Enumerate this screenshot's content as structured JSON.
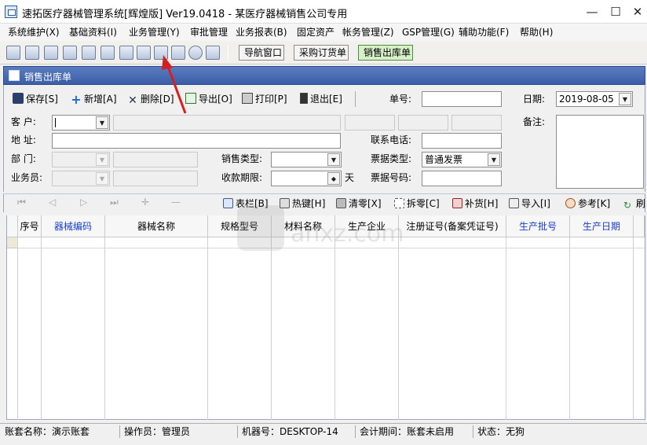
{
  "window": {
    "title": "速拓医疗器械管理系统[辉煌版] Ver19.0418 - 某医疗器械销售公司专用",
    "min_label": "—",
    "max_label": "☐",
    "close_label": "✕"
  },
  "menu": [
    "系统维护(X)",
    "基础资料(I)",
    "业务管理(Y)",
    "审批管理",
    "业务报表(B)",
    "固定资产",
    "帐务管理(Z)",
    "GSP管理(G)",
    "辅助功能(F)",
    "帮助(H)"
  ],
  "toolbar": {
    "nav_window": "导航窗口",
    "purchase_order": "采购订货单",
    "sales_out": "销售出库单"
  },
  "panel": {
    "title": "销售出库单"
  },
  "actions": {
    "save": "保存[S]",
    "add": "新增[A]",
    "delete": "删除[D]",
    "export": "导出[O]",
    "print": "打印[P]",
    "exit": "退出[E]"
  },
  "form": {
    "order_no_label": "单号:",
    "order_no": "",
    "date_label": "日期:",
    "date": "2019-08-05",
    "customer_label": "客    户:",
    "address_label": "地    址:",
    "dept_label": "部    门:",
    "salesman_label": "业务员:",
    "sale_type_label": "销售类型:",
    "term_label": "收款期限:",
    "term_unit": "天",
    "phone_label": "联系电话:",
    "invoice_type_label": "票据类型:",
    "invoice_type": "普通发票",
    "invoice_no_label": "票据号码:",
    "remark_label": "备注:"
  },
  "grid_tools": {
    "columns": "表栏[B]",
    "hotkey": "热键[H]",
    "clear": "清零[X]",
    "split": "拆零[C]",
    "restock": "补货[H]",
    "import": "导入[I]",
    "reference": "参考[K]",
    "more": "刷"
  },
  "grid": {
    "columns": [
      {
        "label": "序号",
        "blue": false
      },
      {
        "label": "器械编码",
        "blue": true
      },
      {
        "label": "器械名称",
        "blue": false
      },
      {
        "label": "规格型号",
        "blue": false
      },
      {
        "label": "材料名称",
        "blue": false
      },
      {
        "label": "生产企业",
        "blue": false
      },
      {
        "label": "注册证号(备案凭证号)",
        "blue": false
      },
      {
        "label": "生产批号",
        "blue": true
      },
      {
        "label": "生产日期",
        "blue": true
      }
    ]
  },
  "watermark": {
    "text": "anxz.com"
  },
  "status": {
    "account": "账套名称：演示账套",
    "operator": "操作员：管理员",
    "machine": "机器号：DESKTOP-14",
    "period": "会计期间：账套未启用",
    "state": "状态：无狗"
  },
  "colors": {
    "panel_header": "#3c5ea8",
    "blue_header_text": "#1a3fc8",
    "annotation_arrow": "#d42020"
  }
}
